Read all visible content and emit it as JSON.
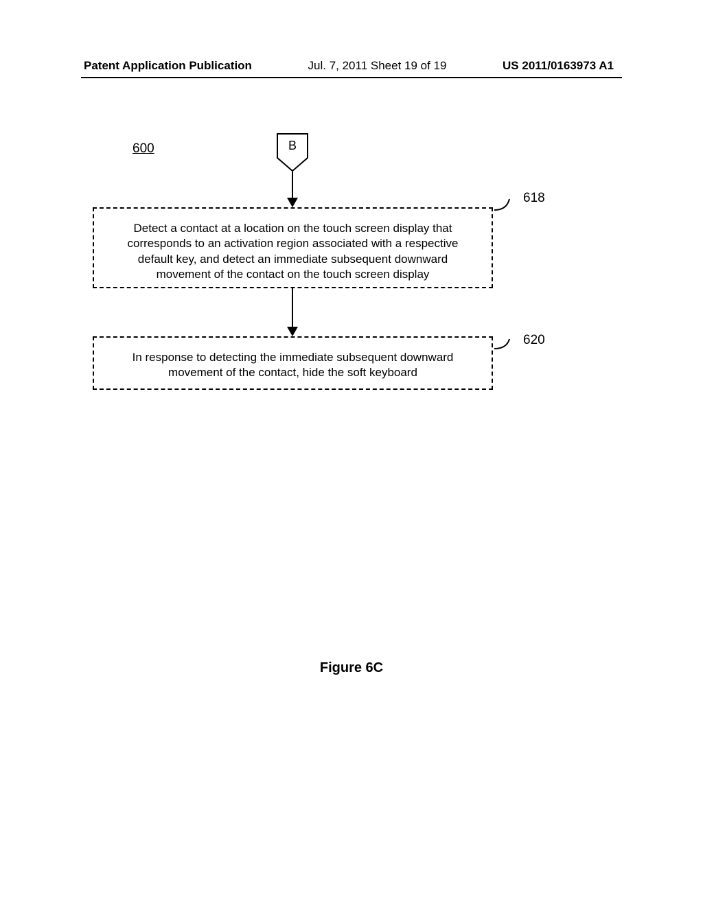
{
  "header": {
    "left": "Patent Application Publication",
    "center": "Jul. 7, 2011   Sheet 19 of 19",
    "right": "US 2011/0163973 A1"
  },
  "flow": {
    "number": "600",
    "connector_label": "B",
    "box618_text": "Detect a contact at a location on the touch screen display that corresponds to an activation region associated with a respective default key, and detect an immediate subsequent downward movement of the contact on the touch screen display",
    "box618_ref": "618",
    "box620_text": "In response to detecting the immediate subsequent downward movement of the contact, hide the soft keyboard",
    "box620_ref": "620"
  },
  "figure_caption": "Figure 6C"
}
